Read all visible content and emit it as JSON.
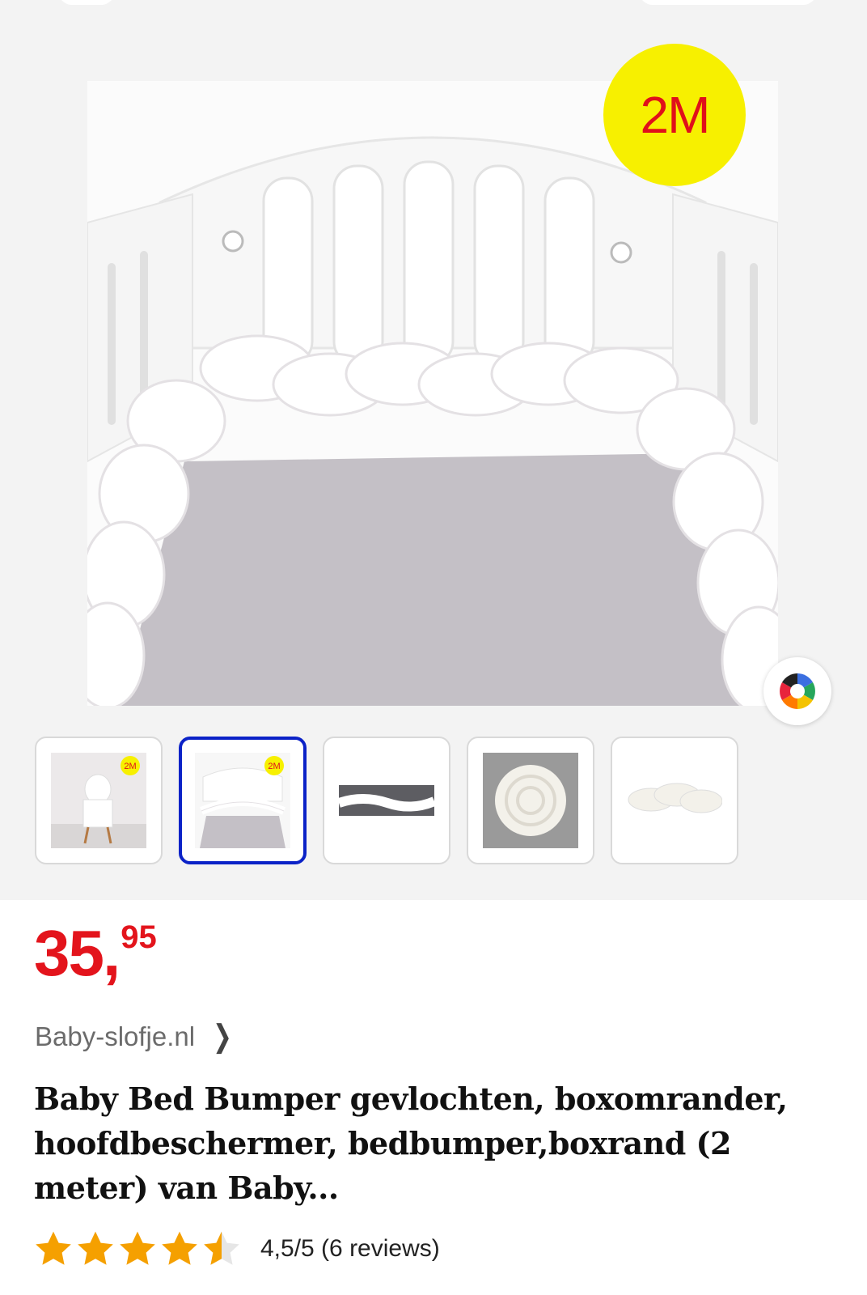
{
  "product": {
    "badge": "2M",
    "thumbnails": [
      {
        "name": "chair-with-bumper",
        "badge": "2M"
      },
      {
        "name": "crib-with-bumper",
        "badge": "2M",
        "active": true
      },
      {
        "name": "bumper-on-bed"
      },
      {
        "name": "bumper-spiral"
      },
      {
        "name": "bumper-closeup"
      }
    ],
    "price": {
      "integer": "35",
      "decimals": "95"
    },
    "seller": "Baby-slofje.nl",
    "title": "Baby Bed Bumper gevlochten, boxomrander, hoofdbeschermer, bedbumper,boxrand (2 meter) van Baby...",
    "rating": {
      "value": 4.5,
      "max": 5,
      "text": "4,5/5 (6 reviews)"
    }
  },
  "colors": {
    "price": "#e3141c",
    "active_thumb_border": "#0b22c7",
    "star": "#f5a000",
    "badge_bg": "#f7f000",
    "badge_text": "#e0101a"
  },
  "icons": {
    "color_picker": "color-wheel-icon",
    "seller_chevron": "chevron-right-icon",
    "star": "star-icon"
  }
}
